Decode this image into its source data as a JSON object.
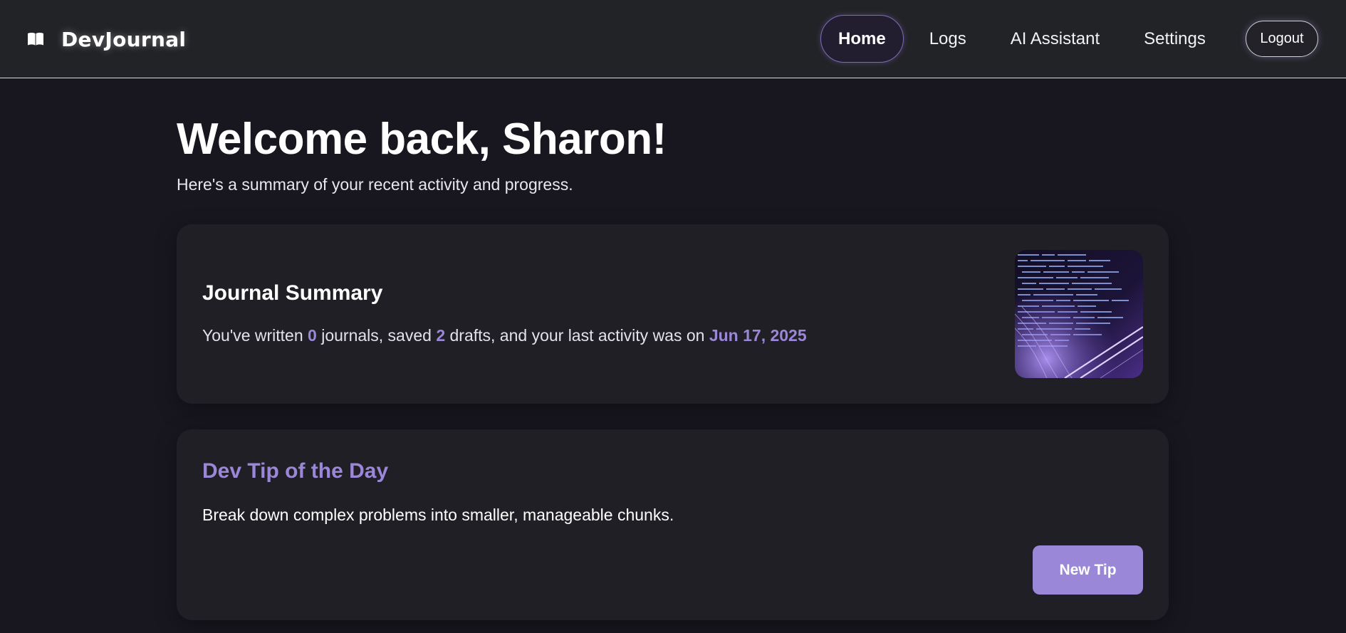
{
  "app": {
    "name": "DevJournal",
    "icon": "open-book-icon"
  },
  "nav": {
    "items": [
      {
        "label": "Home",
        "active": true
      },
      {
        "label": "Logs",
        "active": false
      },
      {
        "label": "AI Assistant",
        "active": false
      },
      {
        "label": "Settings",
        "active": false
      }
    ],
    "logout_label": "Logout"
  },
  "header": {
    "welcome": "Welcome back, Sharon!",
    "subtitle": "Here's a summary of your recent activity and progress."
  },
  "summary": {
    "title": "Journal Summary",
    "text_prefix": "You've written",
    "journals_count": "0",
    "text_mid1": "journals, saved",
    "drafts_count": "2",
    "text_mid2": "drafts, and your last activity was on",
    "last_activity": "Jun 17, 2025",
    "image": "code-screen-image"
  },
  "tip": {
    "title": "Dev Tip of the Day",
    "text": "Break down complex problems into smaller, manageable chunks.",
    "button_label": "New Tip"
  },
  "colors": {
    "background": "#18161f",
    "navbar": "#222327",
    "card": "#201f26",
    "accent": "#9b87d8"
  }
}
